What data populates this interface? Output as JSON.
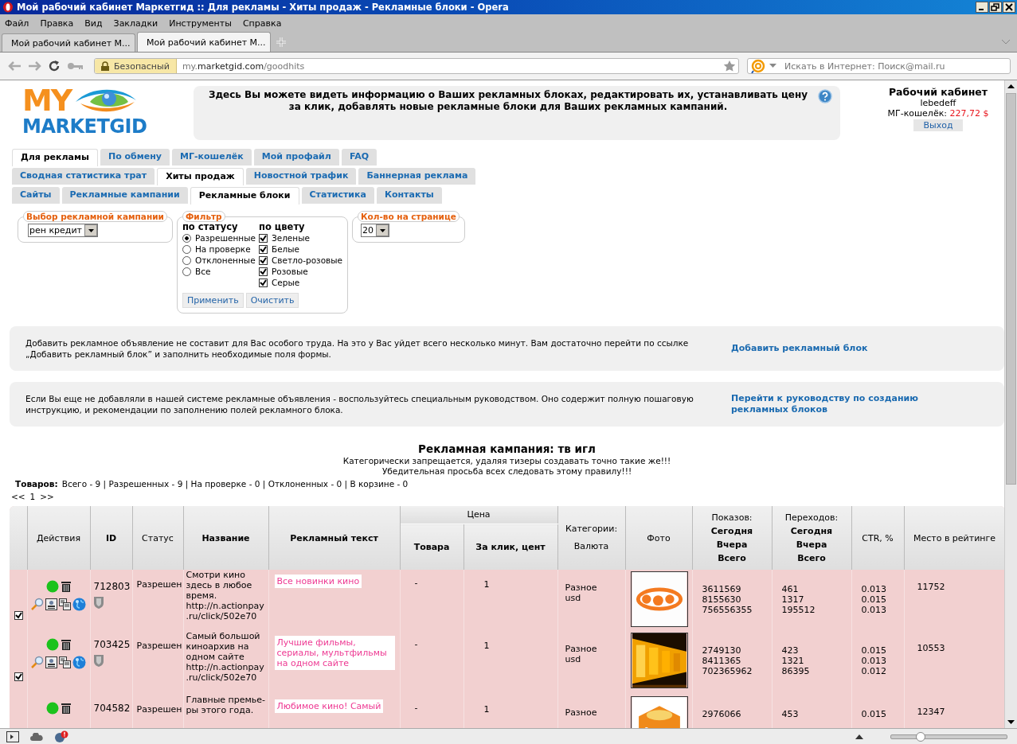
{
  "browser": {
    "title": "Мой рабочий кабинет Маркетгид :: Для рекламы - Хиты продаж - Рекламные блоки - Opera",
    "menu": [
      "Файл",
      "Правка",
      "Вид",
      "Закладки",
      "Инструменты",
      "Справка"
    ],
    "tabs": [
      {
        "label": "Мой рабочий кабинет М...",
        "selected": false
      },
      {
        "label": "Мой рабочий кабинет М...",
        "selected": true
      }
    ],
    "security": "Безопасный",
    "url": {
      "subdomain": "my.",
      "domain": "marketgid.com",
      "path": "/goodhits"
    },
    "search": {
      "placeholder": "Искать в Интернет: Поиск@mail.ru"
    },
    "zoom": {
      "level": 0.25
    }
  },
  "logo": {
    "top": "MY",
    "bottom": "MARKETGID"
  },
  "header": {
    "description": "Здесь Вы можете видеть информацию о Ваших рекламных блоках, редактировать их, устанавливать цену за клик, добавлять новые рекламные блоки для Ваших рекламных кампаний.",
    "user": {
      "title": "Рабочий кабинет",
      "username": "lebedeff",
      "wallet_label": "МГ-кошелёк:",
      "wallet_amount": "227,72 $",
      "logout": "Выход"
    }
  },
  "nav_tabs": [
    [
      {
        "label": "Для рекламы",
        "selected": true
      },
      {
        "label": "По обмену",
        "selected": false
      },
      {
        "label": "МГ-кошелёк",
        "selected": false
      },
      {
        "label": "Мой профайл",
        "selected": false
      },
      {
        "label": "FAQ",
        "selected": false
      }
    ],
    [
      {
        "label": "Сводная статистика трат",
        "selected": false
      },
      {
        "label": "Хиты продаж",
        "selected": true
      },
      {
        "label": "Новостной трафик",
        "selected": false
      },
      {
        "label": "Баннерная реклама",
        "selected": false
      }
    ],
    [
      {
        "label": "Сайты",
        "selected": false
      },
      {
        "label": "Рекламные кампании",
        "selected": false
      },
      {
        "label": "Рекламные блоки",
        "selected": true
      },
      {
        "label": "Статистика",
        "selected": false
      },
      {
        "label": "Контакты",
        "selected": false
      }
    ]
  ],
  "campaign_select": {
    "legend": "Выбор рекламной кампании",
    "value": "рен кредит"
  },
  "filter": {
    "legend": "Фильтр",
    "status_heading": "по статусу",
    "statuses": [
      {
        "label": "Разрешенные",
        "selected": true
      },
      {
        "label": "На проверке",
        "selected": false
      },
      {
        "label": "Отклоненные",
        "selected": false
      },
      {
        "label": "Все",
        "selected": false
      }
    ],
    "color_heading": "по цвету",
    "colors": [
      {
        "label": "Зеленые",
        "checked": true
      },
      {
        "label": "Белые",
        "checked": true
      },
      {
        "label": "Светло-розовые",
        "checked": true
      },
      {
        "label": "Розовые",
        "checked": true
      },
      {
        "label": "Серые",
        "checked": true
      }
    ],
    "buttons": [
      "Применить",
      "Очистить"
    ]
  },
  "per_page": {
    "legend": "Кол-во на странице",
    "value": "20"
  },
  "notices": [
    {
      "text": "Добавить рекламное объявление не составит для Вас особого труда. На это у Вас уйдет всего несколько минут. Вам достаточно перейти по ссылке „Добавить рекламный блок” и заполнить необходимые поля формы.",
      "link": "Добавить рекламный блок"
    },
    {
      "text": "Если Вы еще не добавляли в нашей системе рекламные объявления - воспользуйтесь специальным руководством. Оно содержит полную пошаговую инструкцию, и рекомендации по заполнению полей рекламного блока.",
      "link": "Перейти к руководству по созданию рекламных блоков"
    }
  ],
  "campaign": {
    "title": "Рекламная кампания: тв игл",
    "warnings": [
      "Категорически запрещается, удаляя тизеры создавать точно такие же!!!",
      "Убедительная просьба всех следовать этому правилу!!!"
    ]
  },
  "counts": {
    "label": "Товаров:",
    "text": "Всего - 9 | Разрешенных - 9 | На проверке - 0 | Отклоненных - 0 | В корзине - 0"
  },
  "pagination": {
    "prev": "<<",
    "current": "1",
    "next": ">>"
  },
  "table": {
    "headers": {
      "actions": "Действия",
      "id": "ID",
      "status": "Статус",
      "name": "Название",
      "ad_text": "Рекламный текст",
      "price": "Цена",
      "price_item": "Товара",
      "price_click": "За клик, цент",
      "categories": [
        "Категории:",
        "Валюта"
      ],
      "photo": "Фото",
      "impressions": {
        "label": "Показов:",
        "lines": [
          "Сегодня",
          "Вчера",
          "Всего"
        ]
      },
      "clicks": {
        "label": "Переходов:",
        "lines": [
          "Сегодня",
          "Вчера",
          "Всего"
        ]
      },
      "ctr": "CTR, %",
      "rating": "Место в рейтинге"
    },
    "rows": [
      {
        "checked": true,
        "id": "712803",
        "status": "Разрешен",
        "name": "Смотри кино здесь в любое время. http://n.actionpay.ru/click/502e70",
        "ad_text": "Все новинки кино",
        "price_item": "-",
        "price_click": "1",
        "category": [
          "Разное",
          "usd"
        ],
        "photo": {
          "kind": "picture"
        },
        "impressions": [
          "3611569",
          "8155630",
          "756556355"
        ],
        "clicks": [
          "461",
          "1317",
          "195512"
        ],
        "ctr": [
          "0.013",
          "0.015",
          "0.013"
        ],
        "rating": "11752"
      },
      {
        "checked": true,
        "id": "703425",
        "status": "Разрешен",
        "name": "Самый большой киноархив на одном сайте http://n.actionpay.ru/click/502e70",
        "ad_text": "Лучшие фильмы, сериалы, мультфильмы на одном сайте",
        "price_item": "-",
        "price_click": "1",
        "category": [
          "Разное",
          "usd"
        ],
        "photo": {
          "kind": "picture"
        },
        "impressions": [
          "2749130",
          "8411365",
          "702365962"
        ],
        "clicks": [
          "423",
          "1321",
          "86395"
        ],
        "ctr": [
          "0.015",
          "0.013",
          "0.012"
        ],
        "rating": "10553"
      },
      {
        "id": "704582",
        "status": "Разрешен",
        "name": "Главные премье-ры этого года.",
        "ad_text": "Любимое кино! Самый",
        "price_item": "-",
        "price_click": "1",
        "category": [
          "Разное"
        ],
        "photo": {
          "kind": "picture"
        },
        "impressions": [
          "2976066"
        ],
        "clicks": [
          "453"
        ],
        "ctr": [
          "0.015"
        ],
        "rating": "12347"
      }
    ]
  }
}
